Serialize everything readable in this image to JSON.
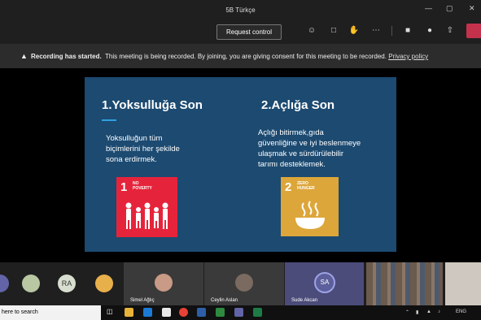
{
  "window": {
    "title": "5B Türkçe"
  },
  "toolbar": {
    "request_control_label": "Request control",
    "icons": [
      "participants-icon",
      "chat-icon",
      "raise-hand-icon",
      "more-icon",
      "camera-icon",
      "mic-icon",
      "share-icon",
      "hangup-icon"
    ]
  },
  "banner": {
    "bold": "Recording has started.",
    "text": "This meeting is being recorded. By joining, you are giving consent for this meeting to be recorded.",
    "link": "Privacy policy"
  },
  "slide": {
    "left_title": "1.Yoksulluğa  Son",
    "right_title": "2.Açlığa Son",
    "left_text": [
      "Yoksulluğun tüm",
      "biçimlerini her şekilde",
      "sona erdirmek."
    ],
    "right_text": [
      "Açlığı bitirmek,gıda",
      "güvenliğine ve iyi beslenmeye",
      "ulaşmak ve sürdürülebilir",
      "tarımı desteklemek."
    ],
    "goal1": {
      "number": "1",
      "label_line1": "NO",
      "label_line2": "POVERTY",
      "color": "#e5243b"
    },
    "goal2": {
      "number": "2",
      "label_line1": "ZERO",
      "label_line2": "HUNGER",
      "color": "#dda63a"
    }
  },
  "participants": [
    {
      "initials": "RA",
      "name": ""
    },
    {
      "name": "Simel Ağlıç"
    },
    {
      "name": "Ceylin Aslan"
    },
    {
      "initials": "SA",
      "name": "Sude Akcan"
    }
  ],
  "taskbar": {
    "search_text": "here to search",
    "lang": "ENG"
  }
}
